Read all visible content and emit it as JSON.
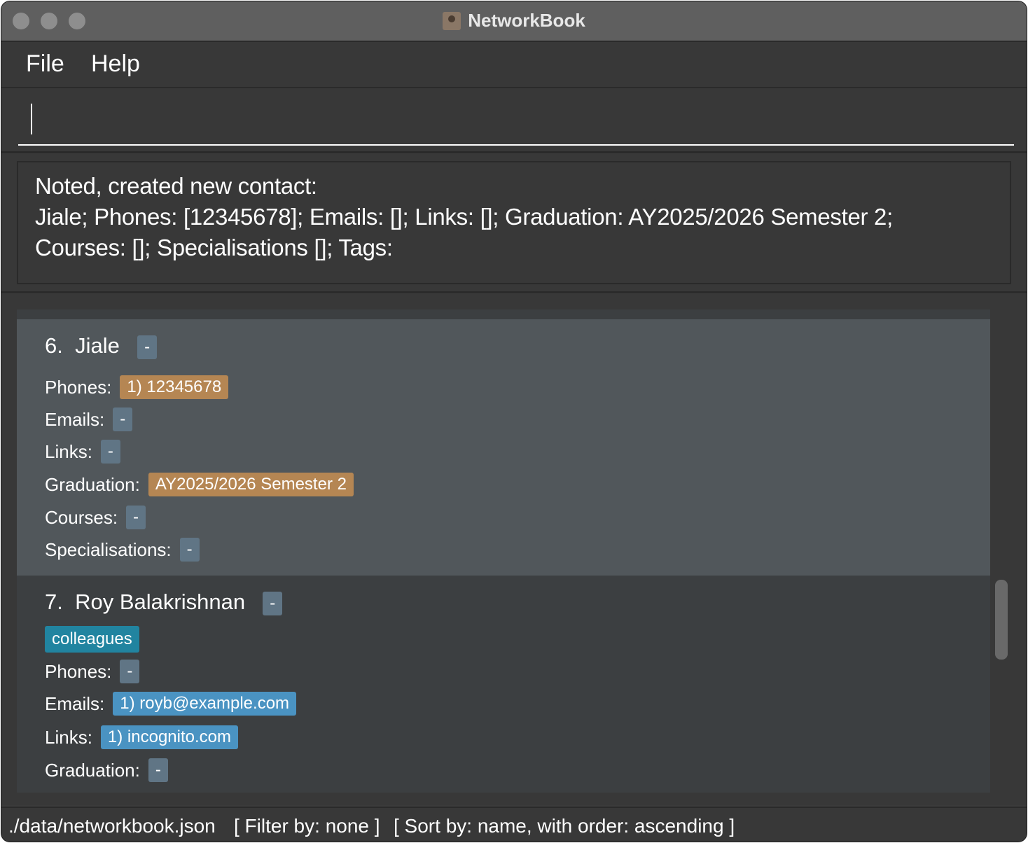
{
  "window": {
    "title": "NetworkBook"
  },
  "menu": {
    "file": "File",
    "help": "Help"
  },
  "command": {
    "value": ""
  },
  "result": {
    "text": "Noted, created new contact:\nJiale; Phones: [12345678]; Emails: []; Links: []; Graduation: AY2025/2026 Semester 2;\nCourses: []; Specialisations []; Tags:"
  },
  "contacts": [
    {
      "index": "6.",
      "name": "Jiale",
      "priority": "-",
      "labels": {
        "phones": "Phones:",
        "emails": "Emails:",
        "links": "Links:",
        "graduation": "Graduation:",
        "courses": "Courses:",
        "specialisations": "Specialisations:"
      },
      "phones": "1) 12345678",
      "emails": "-",
      "links": "-",
      "graduation": "AY2025/2026 Semester 2",
      "courses": "-",
      "specialisations": "-"
    },
    {
      "index": "7.",
      "name": "Roy Balakrishnan",
      "priority": "-",
      "tag": "colleagues",
      "labels": {
        "phones": "Phones:",
        "emails": "Emails:",
        "links": "Links:",
        "graduation": "Graduation:"
      },
      "phones": "-",
      "emails": "1) royb@example.com",
      "links": "1) incognito.com",
      "graduation": "-"
    }
  ],
  "status": {
    "file": "./data/networkbook.json",
    "filter": "[ Filter by: none ]",
    "sort": "[ Sort by: name, with order: ascending ]"
  },
  "colors": {
    "empty_badge": "#607585",
    "orange_badge": "#b58653",
    "blue_badge": "#4a93c2",
    "tag_badge": "#2184a0",
    "selected_card": "#51575b"
  }
}
